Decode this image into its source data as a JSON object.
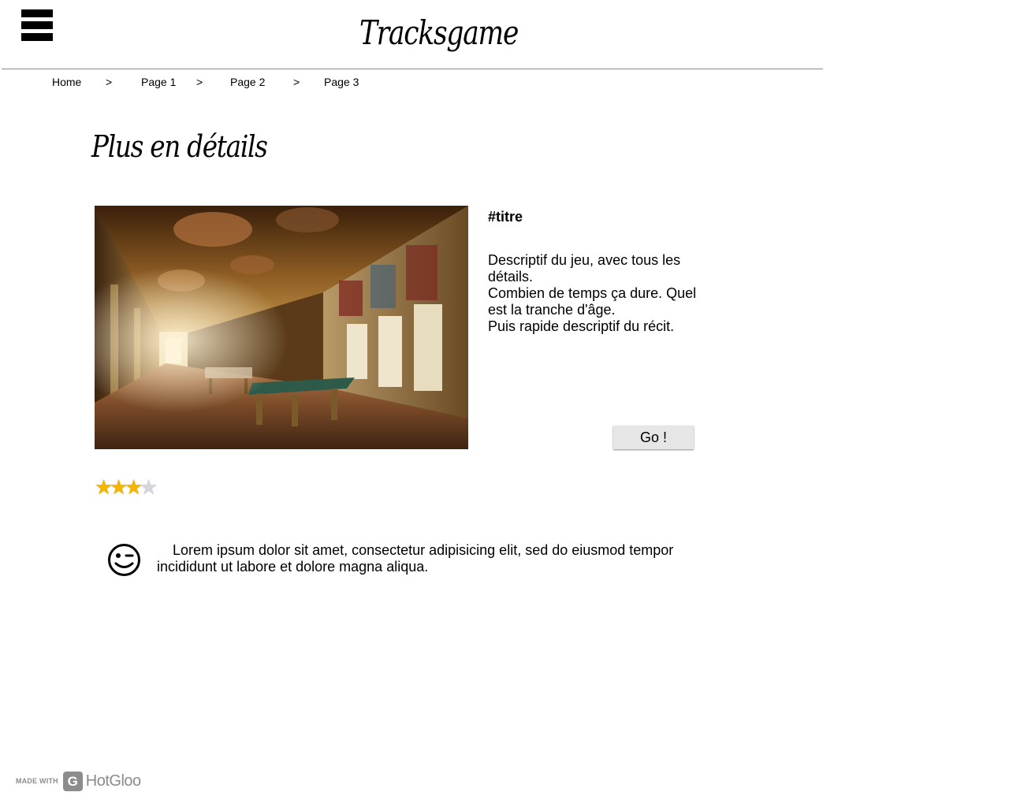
{
  "header": {
    "brand": "Tracksgame"
  },
  "breadcrumb": {
    "items": [
      "Home",
      "Page 1",
      "Page 2",
      "Page 3"
    ],
    "separator": ">"
  },
  "section": {
    "title": "Plus en détails"
  },
  "game": {
    "title": "#titre",
    "description_lines": [
      "Descriptif du jeu, avec tous les détails.",
      "Combien de temps ça dure. Quel est la tranche d'âge.",
      "Puis rapide descriptif du récit."
    ],
    "cta_label": "Go !",
    "image_icon": "gallery-hall-photo"
  },
  "rating": {
    "value": 3,
    "max": 4,
    "star_glyph": "★",
    "on_color": "#f4b400",
    "off_color": "#d8d4dc"
  },
  "comment": {
    "icon": "wink-icon",
    "text": "Lorem ipsum dolor sit amet, consectetur adipisicing elit, sed do eiusmod tempor incididunt ut labore et dolore magna aliqua."
  },
  "footer": {
    "made_with": "MADE WITH",
    "logo_letter": "G",
    "brand": "HotGloo"
  }
}
